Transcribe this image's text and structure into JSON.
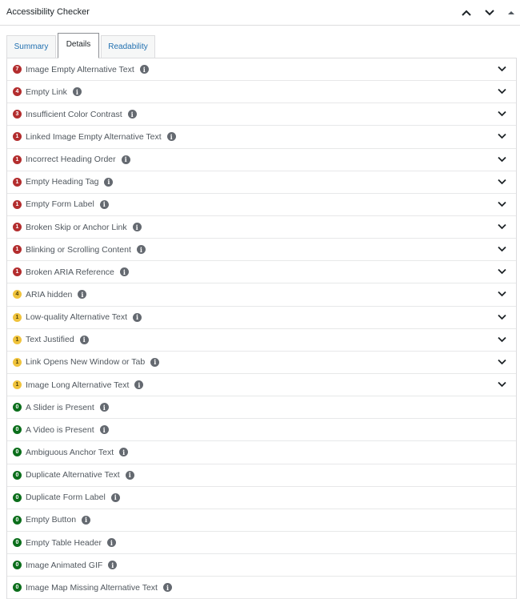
{
  "panel": {
    "title": "Accessibility Checker"
  },
  "tabs": [
    {
      "label": "Summary",
      "active": false
    },
    {
      "label": "Details",
      "active": true
    },
    {
      "label": "Readability",
      "active": false
    }
  ],
  "colors": {
    "error": "#b32d2e",
    "warning": "#f0c33c",
    "passed": "#0b6e1b",
    "info_icon": "#646970"
  },
  "checks": [
    {
      "count": "7",
      "label": "Image Empty Alternative Text",
      "level": "error",
      "expandable": true
    },
    {
      "count": "4",
      "label": "Empty Link",
      "level": "error",
      "expandable": true
    },
    {
      "count": "3",
      "label": "Insufficient Color Contrast",
      "level": "error",
      "expandable": true
    },
    {
      "count": "1",
      "label": "Linked Image Empty Alternative Text",
      "level": "error",
      "expandable": true
    },
    {
      "count": "1",
      "label": "Incorrect Heading Order",
      "level": "error",
      "expandable": true
    },
    {
      "count": "1",
      "label": "Empty Heading Tag",
      "level": "error",
      "expandable": true
    },
    {
      "count": "1",
      "label": "Empty Form Label",
      "level": "error",
      "expandable": true
    },
    {
      "count": "1",
      "label": "Broken Skip or Anchor Link",
      "level": "error",
      "expandable": true
    },
    {
      "count": "1",
      "label": "Blinking or Scrolling Content",
      "level": "error",
      "expandable": true
    },
    {
      "count": "1",
      "label": "Broken ARIA Reference",
      "level": "error",
      "expandable": true
    },
    {
      "count": "4",
      "label": "ARIA hidden",
      "level": "warning",
      "expandable": true
    },
    {
      "count": "1",
      "label": "Low-quality Alternative Text",
      "level": "warning",
      "expandable": true
    },
    {
      "count": "1",
      "label": "Text Justified",
      "level": "warning",
      "expandable": true
    },
    {
      "count": "1",
      "label": "Link Opens New Window or Tab",
      "level": "warning",
      "expandable": true
    },
    {
      "count": "1",
      "label": "Image Long Alternative Text",
      "level": "warning",
      "expandable": true
    },
    {
      "count": "0",
      "label": "A Slider is Present",
      "level": "passed",
      "expandable": false
    },
    {
      "count": "0",
      "label": "A Video is Present",
      "level": "passed",
      "expandable": false
    },
    {
      "count": "0",
      "label": "Ambiguous Anchor Text",
      "level": "passed",
      "expandable": false
    },
    {
      "count": "0",
      "label": "Duplicate Alternative Text",
      "level": "passed",
      "expandable": false
    },
    {
      "count": "0",
      "label": "Duplicate Form Label",
      "level": "passed",
      "expandable": false
    },
    {
      "count": "0",
      "label": "Empty Button",
      "level": "passed",
      "expandable": false
    },
    {
      "count": "0",
      "label": "Empty Table Header",
      "level": "passed",
      "expandable": false
    },
    {
      "count": "0",
      "label": "Image Animated GIF",
      "level": "passed",
      "expandable": false
    },
    {
      "count": "0",
      "label": "Image Map Missing Alternative Text",
      "level": "passed",
      "expandable": false
    }
  ]
}
